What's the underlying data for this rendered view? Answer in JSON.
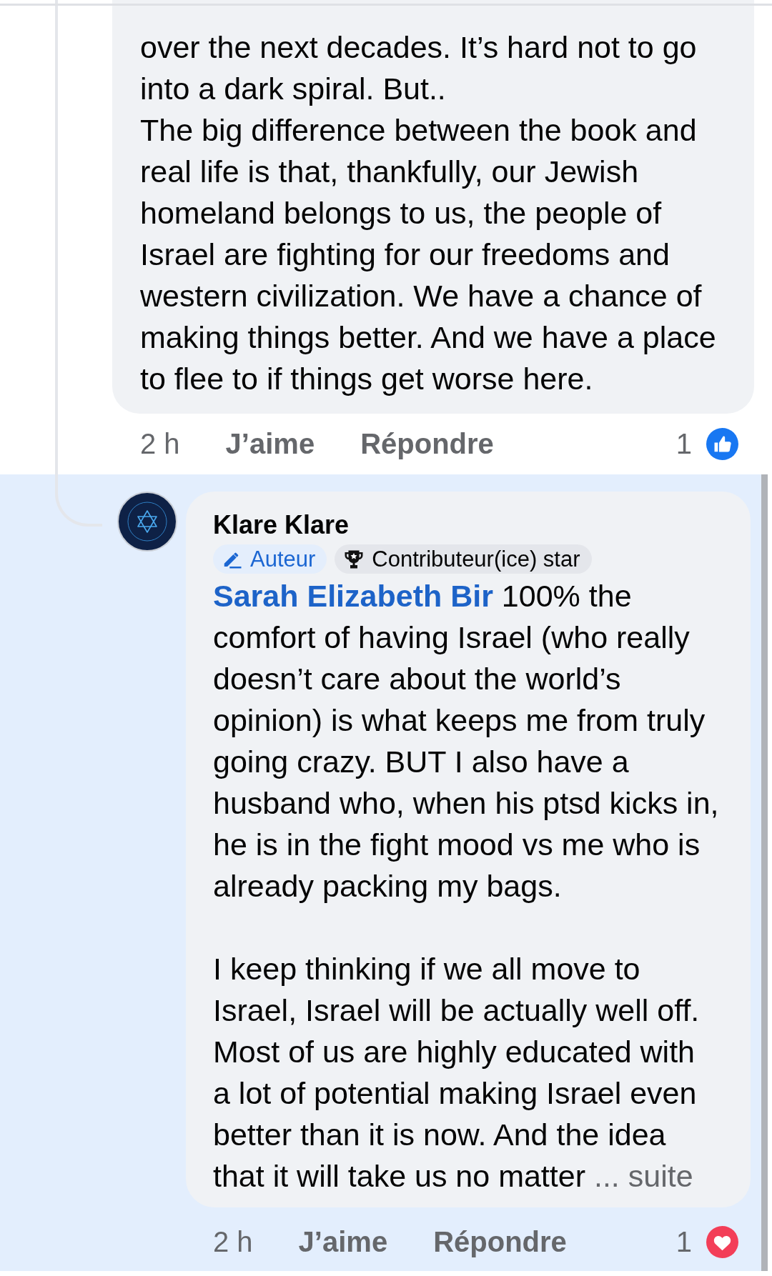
{
  "comment": {
    "text": "over the next decades. It’s hard not to go\ninto a dark spiral. But..\nThe big difference between the book and\nreal life is that, thankfully, our Jewish\nhomeland belongs to us, the people of\nIsrael are fighting for our freedoms and\nwestern civilization. We have a chance of\nmaking things better. And we have a place\nto flee to if things get worse here.",
    "time": "2 h",
    "like_label": "J’aime",
    "reply_label": "Répondre",
    "reaction": {
      "kind": "like",
      "count": "1"
    }
  },
  "reply": {
    "highlighted": true,
    "author": "Klare Klare",
    "badges": [
      {
        "kind": "author",
        "label": "Auteur"
      },
      {
        "kind": "top_contributor",
        "label": "Contributeur(ice) star"
      }
    ],
    "mention": "Sarah Elizabeth Bir",
    "paragraphs": [
      "100% the\ncomfort of having Israel (who really\ndoesn’t care about the world’s\nopinion) is what keeps me from truly\ngoing crazy. BUT I also have a\nhusband who, when his ptsd kicks in,\nhe is in the fight mood vs me who is\nalready packing my bags.",
      "I keep thinking if we all move to\nIsrael, Israel will be actually well off.\nMost of us are highly educated with\na lot of potential making Israel even\nbetter than it is now. And the idea\nthat it will take us no matter"
    ],
    "see_more": "... suite",
    "time": "2 h",
    "like_label": "J’aime",
    "reply_label": "Répondre",
    "reaction": {
      "kind": "love",
      "count": "1"
    }
  }
}
